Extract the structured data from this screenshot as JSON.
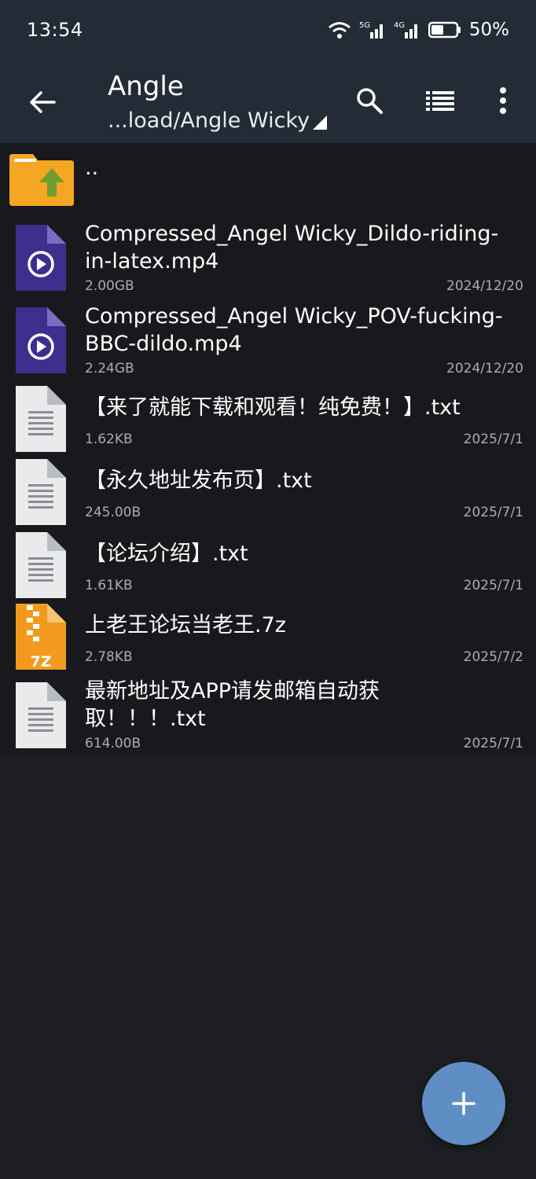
{
  "status_bar": {
    "time": "13:54",
    "network1": "5G",
    "network2": "4G",
    "battery_percent": "50%"
  },
  "app_bar": {
    "title": "Angle",
    "path": "...load/Angle Wicky",
    "icons": [
      "back-arrow-icon",
      "search-icon",
      "list-view-icon",
      "more-vert-icon"
    ]
  },
  "parent_dir": {
    "label": ".."
  },
  "files": [
    {
      "name": "Compressed_Angel Wicky_Dildo-riding-in-latex.mp4",
      "size": "2.00GB",
      "date": "2024/12/20",
      "type": "video"
    },
    {
      "name": "Compressed_Angel Wicky_POV-fucking-BBC-dildo.mp4",
      "size": "2.24GB",
      "date": "2024/12/20",
      "type": "video"
    },
    {
      "name": "【来了就能下载和观看！纯免费！】.txt",
      "size": "1.62KB",
      "date": "2025/7/1",
      "type": "text"
    },
    {
      "name": "【永久地址发布页】.txt",
      "size": "245.00B",
      "date": "2025/7/1",
      "type": "text"
    },
    {
      "name": "【论坛介绍】.txt",
      "size": "1.61KB",
      "date": "2025/7/1",
      "type": "text"
    },
    {
      "name": "上老王论坛当老王.7z",
      "size": "2.78KB",
      "date": "2025/7/2",
      "type": "archive",
      "badge": "7Z"
    },
    {
      "name": "最新地址及APP请发邮箱自动获取！！！.txt",
      "size": "614.00B",
      "date": "2025/7/1",
      "type": "text"
    }
  ],
  "colors": {
    "appbar": "#222b36",
    "list_bg": "#18191c",
    "video_icon": "#3c2f8e",
    "archive_icon": "#f29a1e",
    "folder_icon": "#f5a623",
    "fab": "#5f8ec4"
  }
}
